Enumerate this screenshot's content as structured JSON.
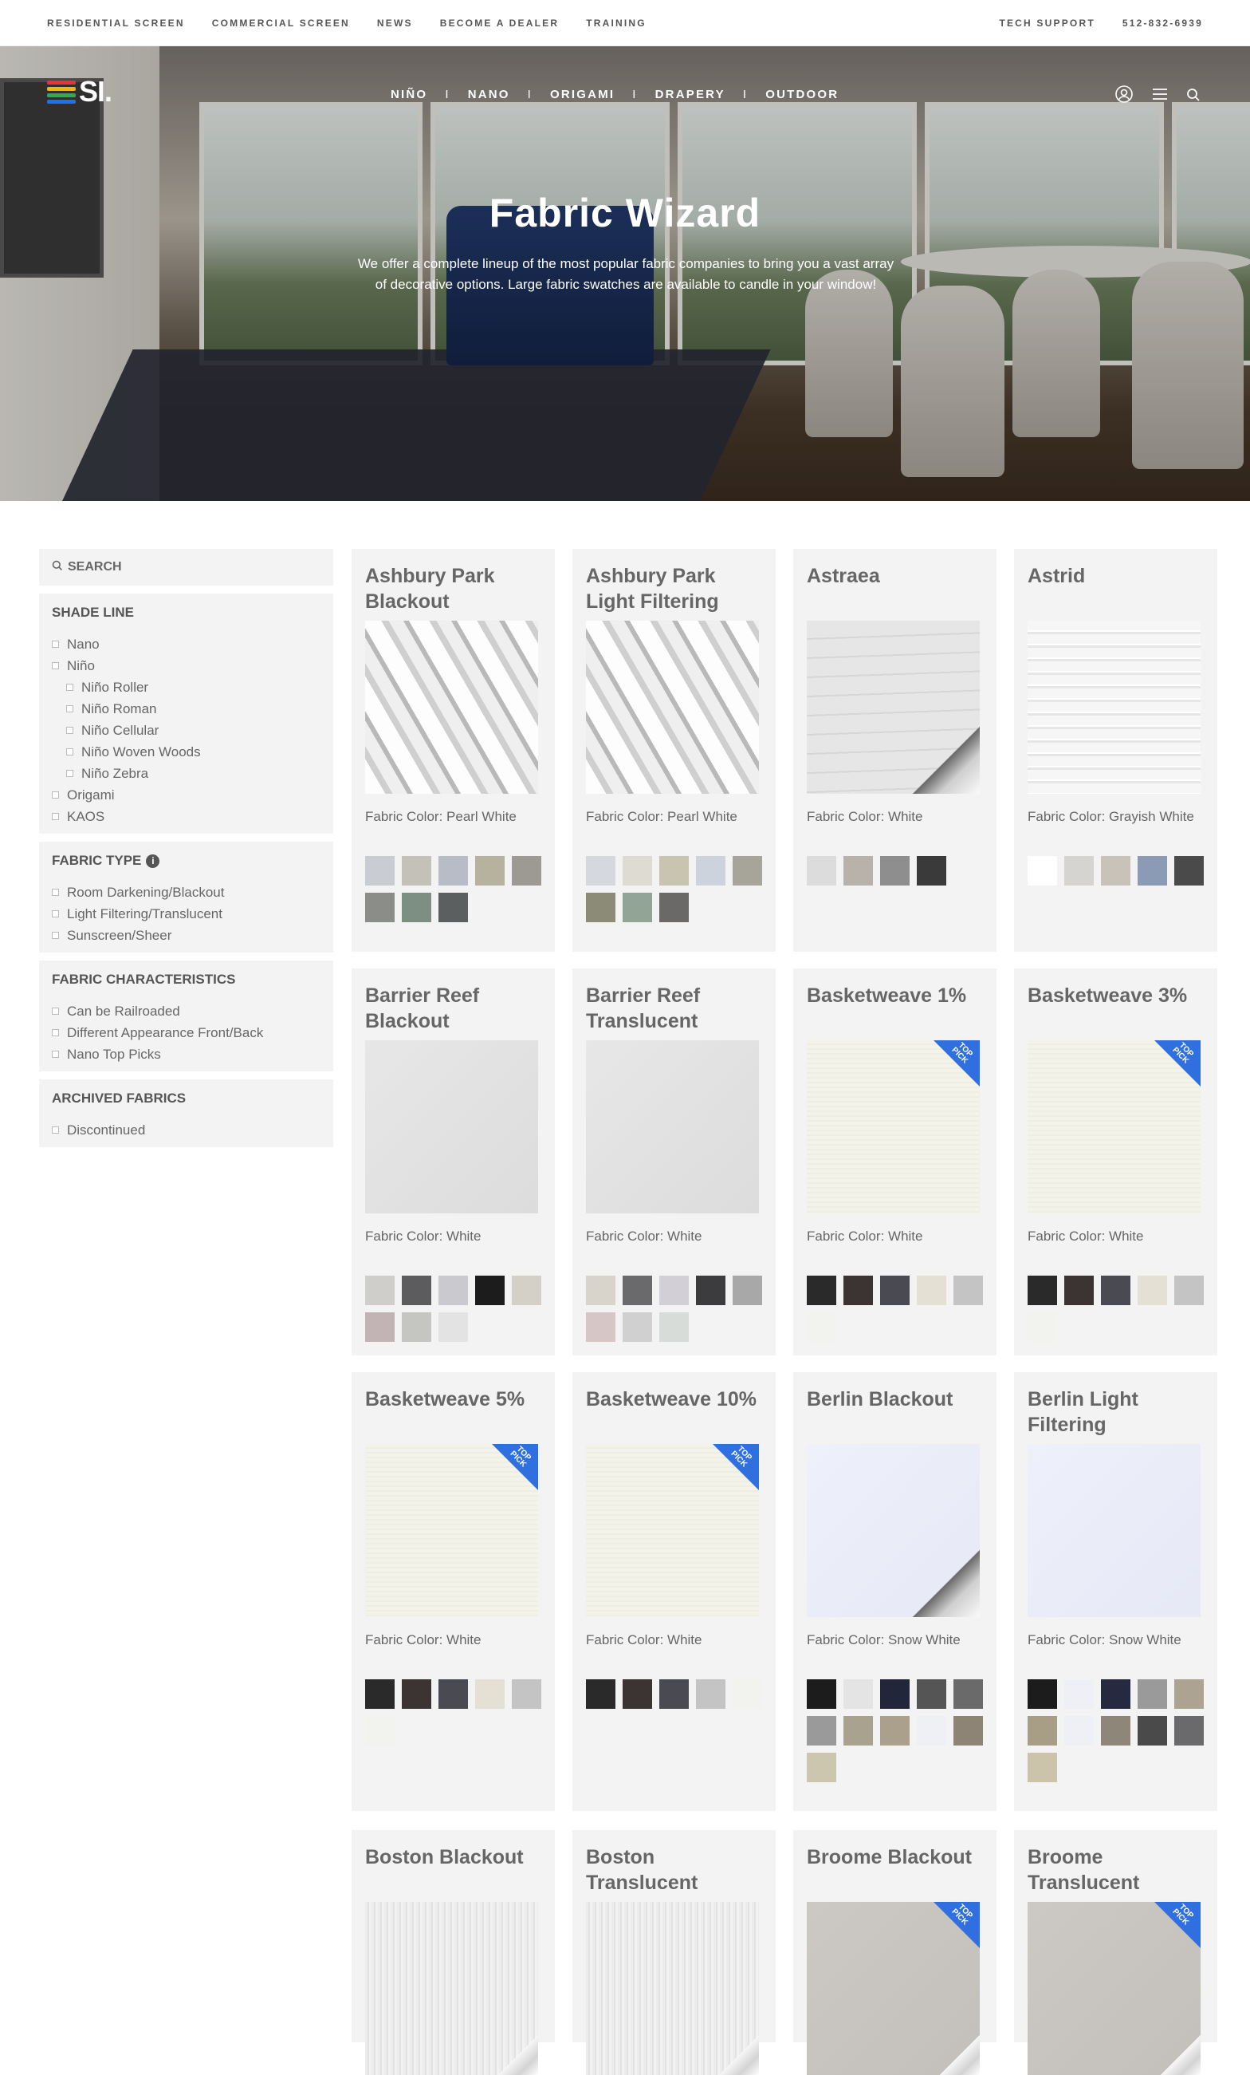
{
  "topbar": {
    "left": [
      "RESIDENTIAL SCREEN",
      "COMMERCIAL SCREEN",
      "NEWS",
      "BECOME A DEALER",
      "TRAINING"
    ],
    "right": [
      "TECH SUPPORT",
      "512-832-6939"
    ]
  },
  "logo": {
    "text": "SI.",
    "colors": [
      "#e8323c",
      "#f4b400",
      "#34a853",
      "#1a73e8"
    ]
  },
  "mainnav": {
    "items": [
      "NIÑO",
      "NANO",
      "ORIGAMI",
      "DRAPERY",
      "OUTDOOR"
    ],
    "separator": "I"
  },
  "header_icons": [
    "user-icon",
    "menu-icon",
    "search-icon"
  ],
  "hero": {
    "title": "Fabric Wizard",
    "text": "We offer a complete lineup of the most popular fabric companies to bring you a vast array of decorative options. Large fabric swatches are available to candle in your window!"
  },
  "sidebar": {
    "search": "SEARCH",
    "shade_line": {
      "title": "SHADE LINE",
      "options": [
        "Nano",
        "Niño",
        "Niño Roller",
        "Niño Roman",
        "Niño Cellular",
        "Niño Woven Woods",
        "Niño Zebra",
        "Origami",
        "KAOS"
      ]
    },
    "fabric_type": {
      "title": "FABRIC TYPE",
      "options": [
        "Room Darkening/Blackout",
        "Light Filtering/Translucent",
        "Sunscreen/Sheer"
      ]
    },
    "fabric_characteristics": {
      "title": "FABRIC CHARACTERISTICS",
      "options": [
        "Can be Railroaded",
        "Different Appearance Front/Back",
        "Nano Top Picks"
      ]
    },
    "archived": {
      "title": "ARCHIVED FABRICS",
      "options": [
        "Discontinued"
      ]
    }
  },
  "badge_text": "TOP PICK",
  "accent": "#3a73d8",
  "cards": [
    {
      "title": "Ashbury Park Blackout",
      "color": "Fabric Color: Pearl White",
      "swatch": "cellular",
      "top_pick": false,
      "thumbs": [
        "#c9ccd3",
        "#c4c2b8",
        "#b8bcc6",
        "#b6b29e",
        "#9c9a92",
        "#8a8d88",
        "#7d8e83",
        "#5c5f60"
      ]
    },
    {
      "title": "Ashbury Park Light Filtering",
      "color": "Fabric Color: Pearl White",
      "swatch": "cellular",
      "top_pick": false,
      "thumbs": [
        "#d5d8de",
        "#dedcd2",
        "#c8c4b0",
        "#ccd3dc",
        "#a7a49a",
        "#8c8b78",
        "#92a495",
        "#6a6968"
      ]
    },
    {
      "title": "Astraea",
      "color": "Fabric Color: White",
      "swatch": "light-curl",
      "top_pick": false,
      "thumbs": [
        "#dcdcdc",
        "#b8b2ab",
        "#8e8e8e",
        "#3a3a3a"
      ]
    },
    {
      "title": "Astrid",
      "color": "Fabric Color: Grayish White",
      "swatch": "stripes",
      "top_pick": false,
      "thumbs": [
        "#ffffff",
        "#d6d4d0",
        "#c9c2b8",
        "#8b9bb6",
        "#4a4a4a"
      ]
    },
    {
      "title": "Barrier Reef Blackout",
      "color": "Fabric Color: White",
      "swatch": "plain-gray",
      "top_pick": false,
      "thumbs": [
        "#d0ceca",
        "#5c5c5e",
        "#cac9cf",
        "#1c1c1c",
        "#d4d0c8",
        "#c2b4b4",
        "#c5c5c2",
        "#e3e3e3"
      ]
    },
    {
      "title": "Barrier Reef Translucent",
      "color": "Fabric Color: White",
      "swatch": "plain-gray",
      "top_pick": false,
      "thumbs": [
        "#d8d4cc",
        "#6a6a6c",
        "#d2d0d6",
        "#3c3c3e",
        "#a8a8a8",
        "#d6c6c6",
        "#d0d0d0",
        "#d8dcd8"
      ]
    },
    {
      "title": "Basketweave 1%",
      "color": "Fabric Color: White",
      "swatch": "cream",
      "top_pick": true,
      "thumbs": [
        "#2a2a2a",
        "#3c3433",
        "#4a4b52",
        "#e4e0d4",
        "#c4c4c4",
        "#f2f2ee"
      ]
    },
    {
      "title": "Basketweave 3%",
      "color": "Fabric Color: White",
      "swatch": "cream",
      "top_pick": true,
      "thumbs": [
        "#2a2a2a",
        "#3c3433",
        "#4a4b52",
        "#e4e0d4",
        "#c4c4c4",
        "#f2f2ee"
      ]
    },
    {
      "title": "Basketweave 5%",
      "color": "Fabric Color: White",
      "swatch": "cream",
      "top_pick": true,
      "thumbs": [
        "#2a2a2a",
        "#3c3433",
        "#4a4b52",
        "#e4e0d4",
        "#c4c4c4",
        "#f2f2ee"
      ]
    },
    {
      "title": "Basketweave 10%",
      "color": "Fabric Color: White",
      "swatch": "cream",
      "top_pick": true,
      "thumbs": [
        "#2a2a2a",
        "#3c3433",
        "#4a4b52",
        "#c4c4c4",
        "#f2f2ee"
      ]
    },
    {
      "title": "Berlin Blackout",
      "color": "Fabric Color: Snow White",
      "swatch": "snow-curl",
      "top_pick": false,
      "thumbs": [
        "#1c1c1c",
        "#e4e4e4",
        "#22263a",
        "#555555",
        "#6a6a6a",
        "#9a9a9a",
        "#a8a28e",
        "#aaa08c",
        "#eef0f6",
        "#8e8476",
        "#cdc6ae"
      ]
    },
    {
      "title": "Berlin Light Filtering",
      "color": "Fabric Color: Snow White",
      "swatch": "snow",
      "top_pick": false,
      "thumbs": [
        "#1c1c1c",
        "#eef0f6",
        "#252a40",
        "#9a9a9a",
        "#aca490",
        "#a89e86",
        "#eef0f6",
        "#8e8678",
        "#4a4a4a",
        "#6a6a6c",
        "#cbc3aa"
      ]
    },
    {
      "title": "Boston Blackout",
      "color": "",
      "swatch": "boston",
      "top_pick": false,
      "thumbs": []
    },
    {
      "title": "Boston Translucent",
      "color": "",
      "swatch": "boston",
      "top_pick": false,
      "thumbs": []
    },
    {
      "title": "Broome Blackout",
      "color": "",
      "swatch": "broome",
      "top_pick": true,
      "thumbs": []
    },
    {
      "title": "Broome Translucent",
      "color": "",
      "swatch": "broome",
      "top_pick": true,
      "thumbs": []
    }
  ]
}
